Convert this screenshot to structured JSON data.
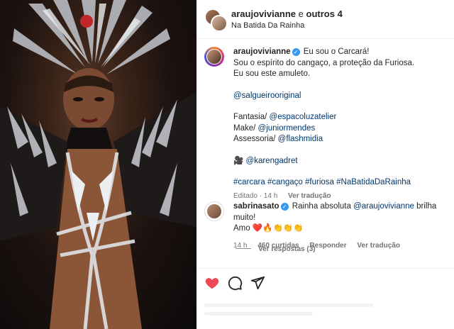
{
  "header": {
    "username": "araujovivianne",
    "conjunction": "e",
    "others": "outros 4",
    "subtitle": "Na Batida Da Rainha"
  },
  "caption": {
    "username": "araujovivianne",
    "line1": "Eu sou o Carcará!",
    "line2": "Sou o espírito do cangaço, a proteção da Furiosa.",
    "line3": "Eu sou este amuleto.",
    "tag_salgueiro": "@salgueirooriginal",
    "fantasia_label": "Fantasia/",
    "fantasia_link": "@espacoluzatelier",
    "make_label": "Make/",
    "make_link": "@juniormendes",
    "assessoria_label": "Assessoria/",
    "assessoria_link": "@flashmidia",
    "camera_emoji": "🎥",
    "camera_link": "@karengadret",
    "hashtags": [
      "#carcara",
      "#cangaço",
      "#furiosa",
      "#NaBatidaDaRainha"
    ],
    "edited": "Editado · 14 h",
    "see_translation": "Ver tradução"
  },
  "comment": {
    "username": "sabrinasato",
    "text_before": "Rainha absoluta",
    "mention": "@araujovivianne",
    "text_after": "brilha muito!",
    "line2": "Amo ❤️🔥👏👏👏",
    "time": "14 h",
    "likes": "460 curtidas",
    "reply": "Responder",
    "translate": "Ver tradução"
  },
  "replies": {
    "label": "Ver respostas (3)"
  },
  "actions": {
    "like_icon": "heart-filled-icon",
    "comment_icon": "comment-bubble-icon",
    "share_icon": "paper-plane-icon",
    "like_color": "#ed4956"
  },
  "colors": {
    "link": "#00376b",
    "muted": "#737373",
    "verified": "#3897f0"
  }
}
